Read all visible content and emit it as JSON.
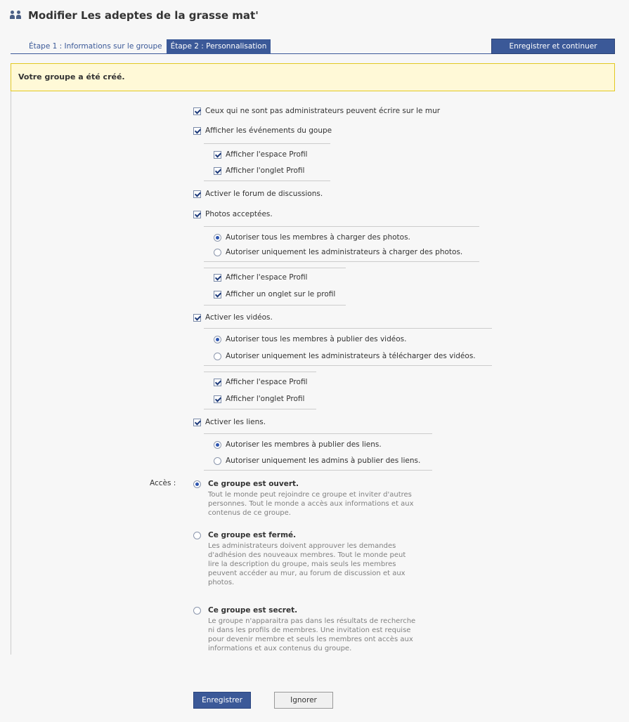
{
  "header": {
    "title": "Modifier Les adeptes de la grasse mat'",
    "icon": "group-icon"
  },
  "tabs": [
    {
      "label": "Étape 1 : Informations sur le groupe",
      "active": false
    },
    {
      "label": "Étape 2 : Personnalisation",
      "active": true
    }
  ],
  "save_continue_label": "Enregistrer et continuer",
  "notice": "Votre groupe a été créé.",
  "options": {
    "wall": "Ceux qui ne sont pas administrateurs peuvent écrire sur le mur",
    "events": "Afficher les événements du goupe",
    "events_box": "Afficher l'espace Profil",
    "events_tab": "Afficher l'onglet Profil",
    "forum": "Activer le forum de discussions.",
    "photos": "Photos acceptées.",
    "photos_all": "Autoriser tous les membres à charger des photos.",
    "photos_admins": "Autoriser uniquement les administrateurs à charger des photos.",
    "photos_box": "Afficher l'espace Profil",
    "photos_tab": "Afficher un onglet sur le profil",
    "videos": "Activer les vidéos.",
    "videos_all": "Autoriser tous les membres à publier des vidéos.",
    "videos_admins": "Autoriser uniquement les administrateurs à télécharger des vidéos.",
    "videos_box": "Afficher l'espace Profil",
    "videos_tab": "Afficher l'onglet Profil",
    "links": "Activer les liens.",
    "links_all": "Autoriser les membres à publier des liens.",
    "links_admins": "Autoriser uniquement les admins à publier des liens."
  },
  "access": {
    "label": "Accès :",
    "open": {
      "title": "Ce groupe est ouvert.",
      "desc": "Tout le monde peut rejoindre ce groupe et inviter d'autres personnes. Tout le monde a accès aux informations et aux contenus de ce groupe."
    },
    "closed": {
      "title": "Ce groupe est fermé.",
      "desc": "Les administrateurs doivent approuver les demandes d'adhésion des nouveaux membres. Tout le monde peut lire la description du groupe, mais seuls les membres peuvent accéder au mur, au forum de discussion et aux photos."
    },
    "secret": {
      "title": "Ce groupe est secret.",
      "desc": "Le groupe n'apparaitra pas dans les résultats de recherche ni dans les profils de membres. Une invitation est requise pour devenir membre et seuls les membres ont accès aux informations et aux contenus du groupe."
    }
  },
  "buttons": {
    "save": "Enregistrer",
    "ignore": "Ignorer"
  },
  "colors": {
    "accent": "#3b5998",
    "notice_bg": "#fff9d7",
    "notice_border": "#e2c822"
  }
}
